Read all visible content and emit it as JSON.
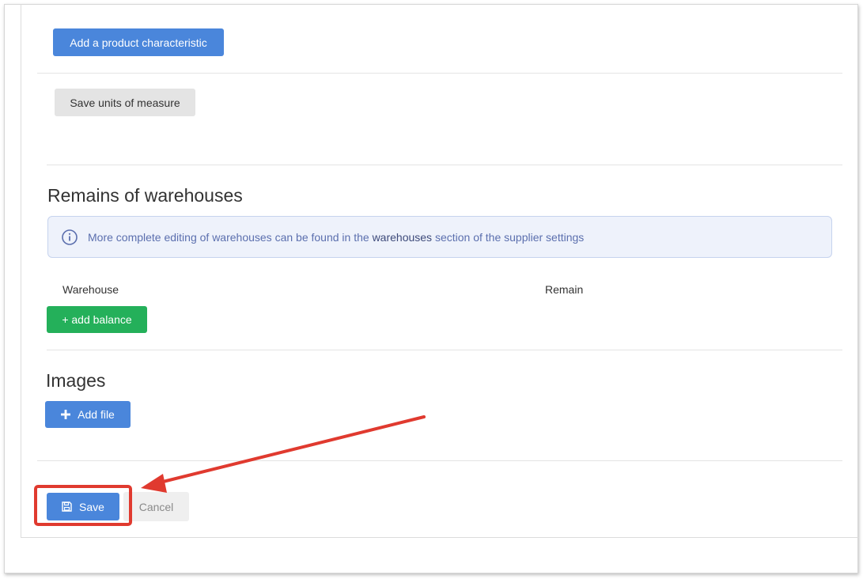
{
  "characteristics": {
    "add_label": "Add a product characteristic"
  },
  "units": {
    "save_label": "Save units of measure"
  },
  "warehouses": {
    "title": "Remains of warehouses",
    "info_prefix": "More complete editing of warehouses can be found in the ",
    "info_link": "warehouses",
    "info_suffix": " section of the supplier settings",
    "col_warehouse": "Warehouse",
    "col_remain": "Remain",
    "add_balance_label": "+ add balance"
  },
  "images": {
    "title": "Images",
    "add_file_label": "Add file",
    "add_icon": "plus-icon"
  },
  "footer": {
    "save_label": "Save",
    "save_icon": "floppy-disk-icon",
    "cancel_label": "Cancel"
  },
  "annotation": {
    "color": "#e03a2f"
  }
}
